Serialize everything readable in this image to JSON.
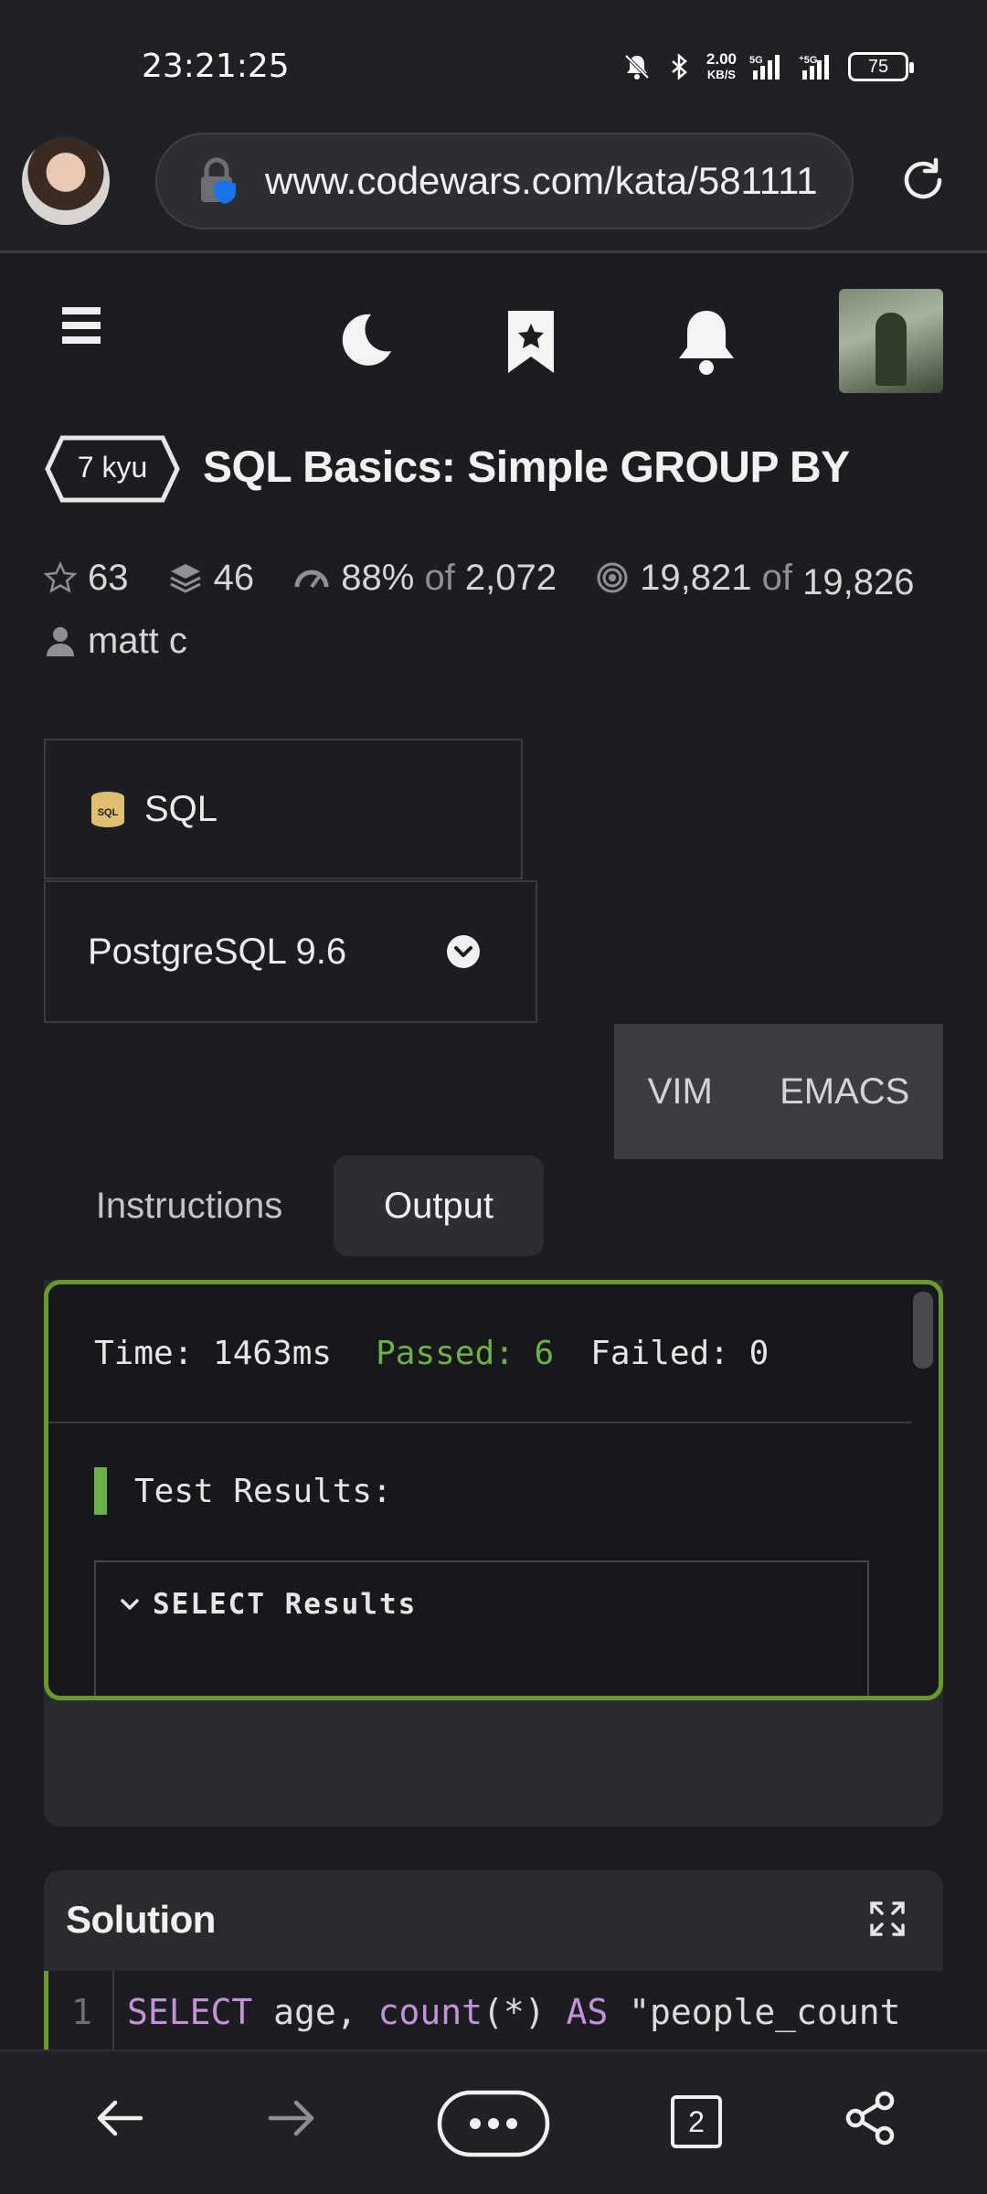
{
  "status_bar": {
    "time": "23:21:25",
    "net_speed_top": "2.00",
    "net_speed_bottom": "KB/S",
    "net1": "5G",
    "net2": "5G",
    "battery": "75"
  },
  "browser": {
    "url": "www.codewars.com/kata/581111"
  },
  "kata": {
    "rank": "7 kyu",
    "title": "SQL Basics: Simple GROUP BY",
    "stars": "63",
    "collections": "46",
    "satisfaction_pct": "88%",
    "satisfaction_of": "of",
    "satisfaction_total": "2,072",
    "completed": "19,821",
    "completed_of": "of",
    "completed_total": "19,826",
    "author": "matt c"
  },
  "language": {
    "name": "SQL",
    "version": "PostgreSQL 9.6"
  },
  "editor_modes": [
    "VIM",
    "EMACS"
  ],
  "tabs": {
    "instructions": "Instructions",
    "output": "Output"
  },
  "output": {
    "time": "Time: 1463ms",
    "passed": "Passed: 6",
    "failed": "Failed: 0",
    "results_label": "Test Results:",
    "select_results": "SELECT Results"
  },
  "solution": {
    "title": "Solution",
    "line_number": "1",
    "code_kw1": "SELECT",
    "code_t1": " age, ",
    "code_fn": "count",
    "code_t2": "(*) ",
    "code_kw2": "AS",
    "code_t3": " \"people_count"
  },
  "bottom_nav": {
    "tab_count": "2"
  },
  "colors": {
    "accent_green": "#6cb048",
    "border_green": "#6a9a2e",
    "keyword": "#c392d8",
    "background": "#1c1d21"
  }
}
